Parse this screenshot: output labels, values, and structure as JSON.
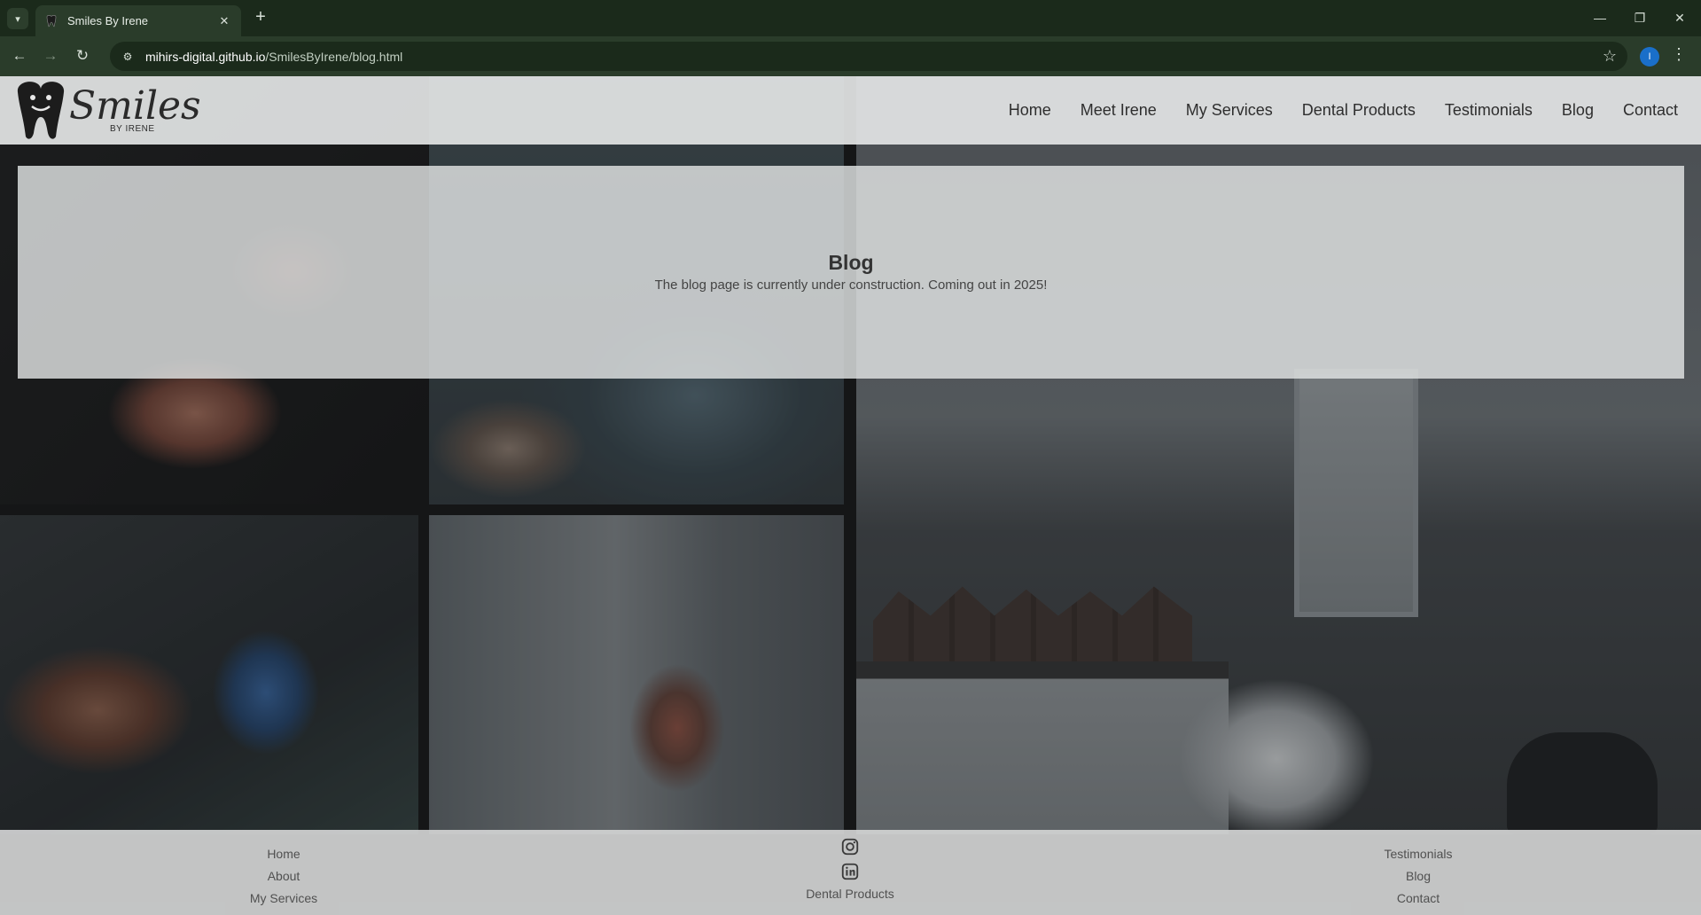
{
  "browser": {
    "tab_title": "Smiles By Irene",
    "url_host": "mihirs-digital.github.io",
    "url_path": "/SmilesByIrene/blog.html",
    "profile_initial": "I"
  },
  "site": {
    "logo_text": "Smiles",
    "logo_subtext": "BY IRENE",
    "nav": [
      "Home",
      "Meet Irene",
      "My Services",
      "Dental Products",
      "Testimonials",
      "Blog",
      "Contact"
    ]
  },
  "blog": {
    "title": "Blog",
    "message": "The blog page is currently under construction. Coming out in 2025!"
  },
  "footer": {
    "left_links": [
      "Home",
      "About",
      "My Services"
    ],
    "middle_label": "Dental Products",
    "social_icons": [
      "instagram-icon",
      "linkedin-icon"
    ],
    "right_links": [
      "Testimonials",
      "Blog",
      "Contact"
    ]
  },
  "colors": {
    "chrome_dark": "#1b2a1b",
    "chrome_bar": "#2a3c2a",
    "header_bg": "#e2e4e4",
    "text_dark": "#2e2e2e"
  }
}
